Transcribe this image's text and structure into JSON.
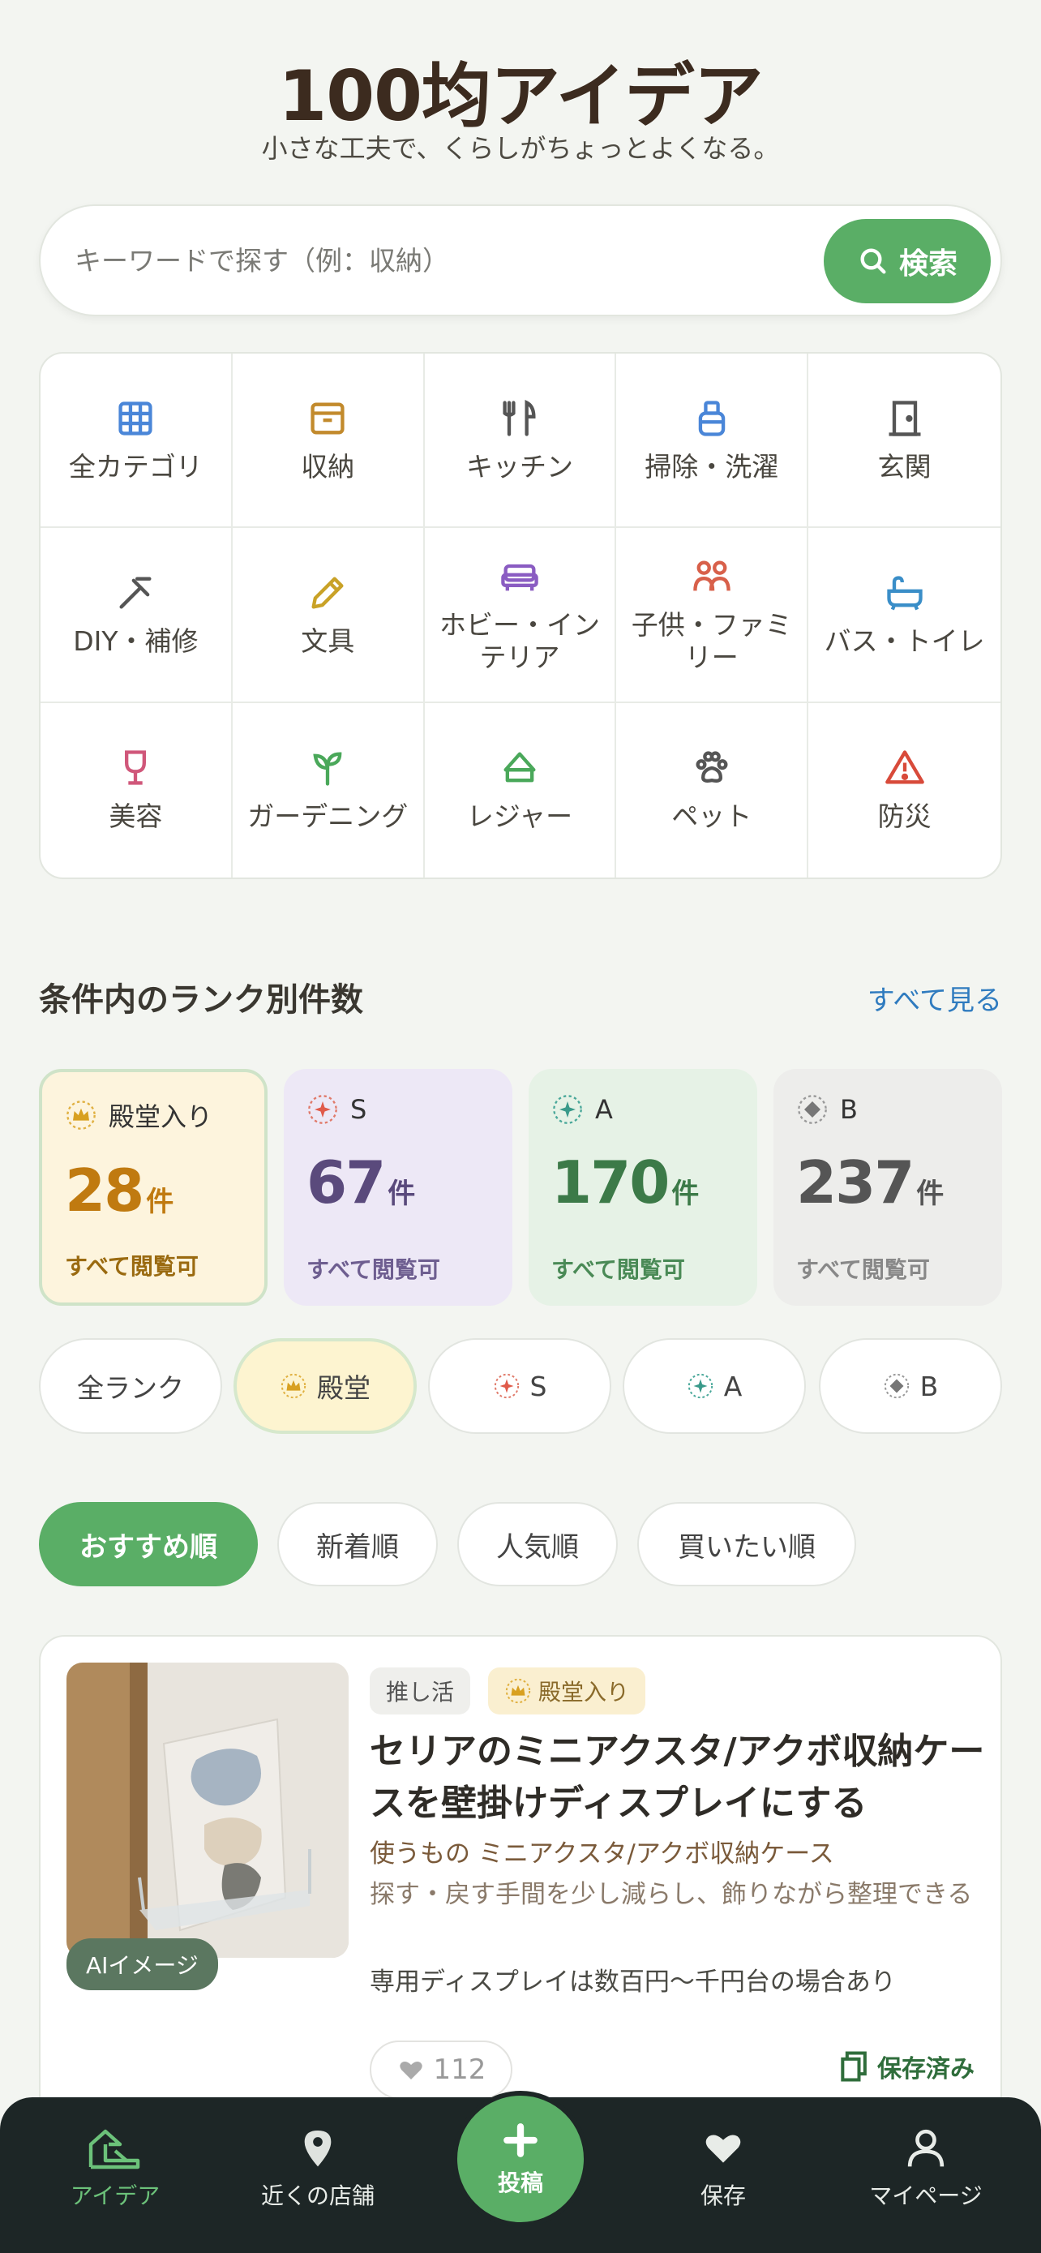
{
  "header": {
    "title": "100均アイデア",
    "subtitle": "小さな工夫で、くらしがちょっとよくなる。"
  },
  "search": {
    "placeholder": "キーワードで探す（例：収納）",
    "button_label": "検索"
  },
  "categories": [
    {
      "label": "全カテゴリ",
      "icon": "grid-icon",
      "color": "#4a86d8"
    },
    {
      "label": "収納",
      "icon": "box-icon",
      "color": "#c28a2c"
    },
    {
      "label": "キッチン",
      "icon": "utensils-icon",
      "color": "#555555"
    },
    {
      "label": "掃除・洗濯",
      "icon": "spray-icon",
      "color": "#4a86d8"
    },
    {
      "label": "玄関",
      "icon": "door-icon",
      "color": "#555555"
    },
    {
      "label": "DIY・補修",
      "icon": "hammer-icon",
      "color": "#555555"
    },
    {
      "label": "文具",
      "icon": "pencil-icon",
      "color": "#c9a227"
    },
    {
      "label": "ホビー・インテリア",
      "icon": "sofa-icon",
      "color": "#8a5cc2"
    },
    {
      "label": "子供・ファミリー",
      "icon": "family-icon",
      "color": "#d8604a"
    },
    {
      "label": "バス・トイレ",
      "icon": "bathtub-icon",
      "color": "#3a8ec8"
    },
    {
      "label": "美容",
      "icon": "glass-icon",
      "color": "#d0577a"
    },
    {
      "label": "ガーデニング",
      "icon": "sprout-icon",
      "color": "#4aa85a"
    },
    {
      "label": "レジャー",
      "icon": "tent-icon",
      "color": "#4aa85a"
    },
    {
      "label": "ペット",
      "icon": "paw-icon",
      "color": "#555555"
    },
    {
      "label": "防災",
      "icon": "warning-icon",
      "color": "#d84a3a"
    }
  ],
  "rank_section": {
    "title": "条件内のランク別件数",
    "see_all": "すべて見る"
  },
  "rank_cards": [
    {
      "label": "殿堂入り",
      "count": "28",
      "unit": "件",
      "note": "すべて閲覧可",
      "bg": "#fdf4dd",
      "fg": "#c07a10"
    },
    {
      "label": "S",
      "count": "67",
      "unit": "件",
      "note": "すべて閲覧可",
      "bg": "#ede8f6",
      "fg": "#5a4a7c"
    },
    {
      "label": "A",
      "count": "170",
      "unit": "件",
      "note": "すべて閲覧可",
      "bg": "#e6f2e6",
      "fg": "#3c7a48"
    },
    {
      "label": "B",
      "count": "237",
      "unit": "件",
      "note": "すべて閲覧可",
      "bg": "#ededeb",
      "fg": "#555555"
    }
  ],
  "rank_filters": [
    "全ランク",
    "殿堂",
    "S",
    "A",
    "B"
  ],
  "sort_options": [
    "おすすめ順",
    "新着順",
    "人気順",
    "買いたい順"
  ],
  "post": {
    "tag_topic": "推し活",
    "tag_rank": "殿堂入り",
    "ai_badge": "AIイメージ",
    "title": "セリアのミニアクスタ/アクボ収納ケースを壁掛けディスプレイにする",
    "uses": "使うもの ミニアクスタ/アクボ収納ケース",
    "benefit": "探す・戻す手間を少し減らし、飾りながら整理できる",
    "note": "専用ディスプレイは数百円〜千円台の場合あり",
    "likes": "112",
    "saved_label": "保存済み"
  },
  "tabbar": {
    "idea": "アイデア",
    "stores": "近くの店舗",
    "post": "投稿",
    "saved": "保存",
    "mypage": "マイページ"
  }
}
